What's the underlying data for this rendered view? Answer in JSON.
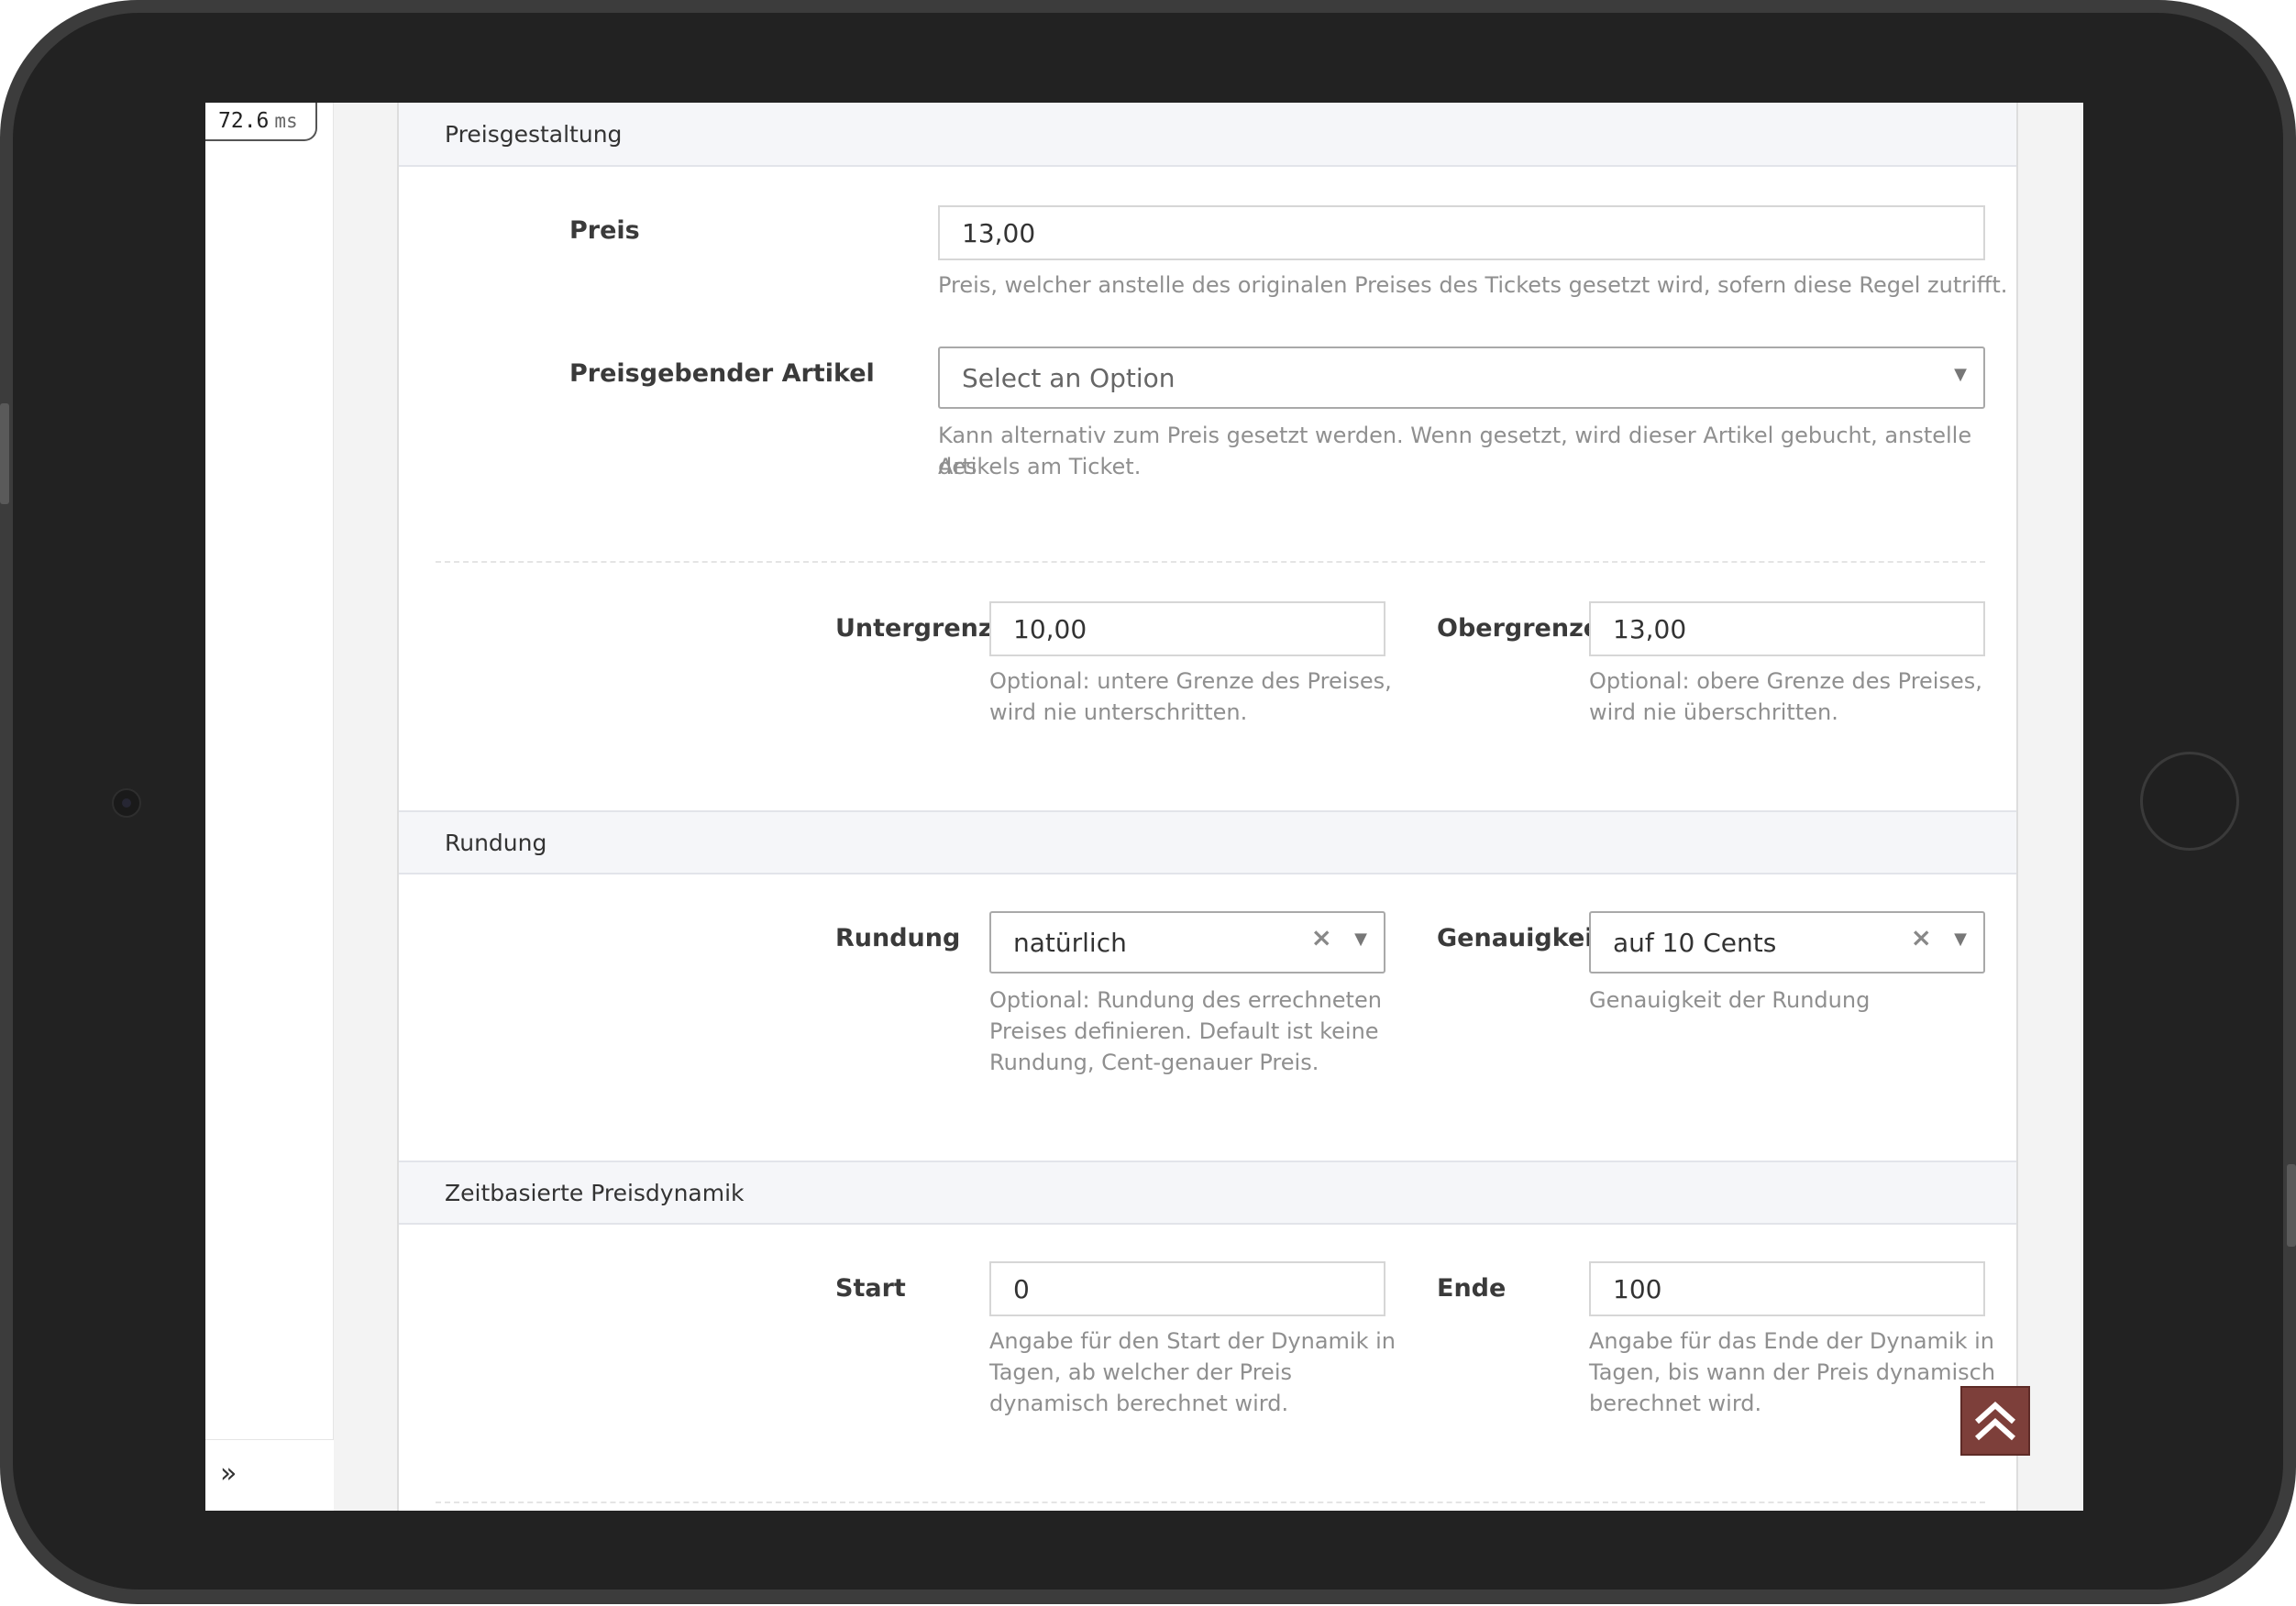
{
  "debug": {
    "timer_value": "72.6",
    "timer_unit": "ms"
  },
  "sidebar": {
    "expand_icon": "double-chevron-right-icon"
  },
  "sections": {
    "pricing": {
      "title": "Preisgestaltung",
      "price_label": "Preis",
      "price_value": "13,00",
      "price_help": "Preis, welcher anstelle des originalen Preises des Tickets gesetzt wird, sofern diese Regel zutrifft.",
      "article_label": "Preisgebender Artikel",
      "article_placeholder": "Select an Option",
      "article_help_1": "Kann alternativ zum Preis gesetzt werden. Wenn gesetzt, wird dieser Artikel gebucht, anstelle des",
      "article_help_2": "Artikels am Ticket.",
      "lower_label": "Untergrenze",
      "lower_value": "10,00",
      "lower_help_1": "Optional: untere Grenze des Preises,",
      "lower_help_2": "wird nie unterschritten.",
      "upper_label": "Obergrenze",
      "upper_value": "13,00",
      "upper_help_1": "Optional: obere Grenze des Preises,",
      "upper_help_2": "wird nie überschritten."
    },
    "rounding": {
      "title": "Rundung",
      "rounding_label": "Rundung",
      "rounding_value": "natürlich",
      "rounding_help_1": "Optional: Rundung des errechneten",
      "rounding_help_2": "Preises definieren. Default ist keine",
      "rounding_help_3": "Rundung, Cent-genauer Preis.",
      "precision_label": "Genauigkeit",
      "precision_value": "auf 10 Cents",
      "precision_help": "Genauigkeit der Rundung"
    },
    "dynamics": {
      "title": "Zeitbasierte Preisdynamik",
      "start_label": "Start",
      "start_value": "0",
      "start_help_1": "Angabe für den Start der Dynamik in",
      "start_help_2": "Tagen, ab welcher der Preis",
      "start_help_3": "dynamisch berechnet wird.",
      "end_label": "Ende",
      "end_value": "100",
      "end_help_1": "Angabe für das Ende der Dynamik in",
      "end_help_2": "Tagen, bis wann der Preis dynamisch",
      "end_help_3": "berechnet wird."
    }
  },
  "icons": {
    "select_caret": "caret-down-icon",
    "clear": "clear-x-icon",
    "scroll_top": "double-chevron-up-icon"
  },
  "colors": {
    "scroll_top_bg": "#7d3f3a",
    "section_header_bg": "#f5f6f9"
  }
}
